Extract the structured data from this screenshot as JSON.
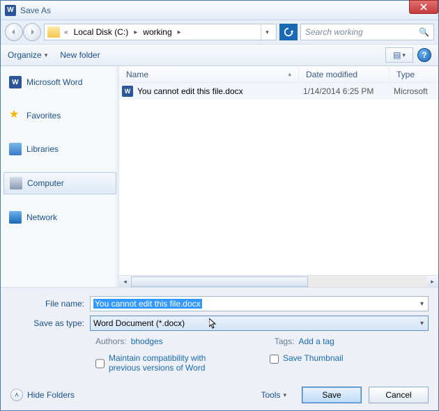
{
  "title": "Save As",
  "breadcrumb": {
    "root_marker": "«",
    "drive": "Local Disk (C:)",
    "folder": "working"
  },
  "search": {
    "placeholder": "Search working"
  },
  "toolbar": {
    "organize": "Organize",
    "new_folder": "New folder"
  },
  "sidebar": {
    "items": [
      {
        "label": "Microsoft Word"
      },
      {
        "label": "Favorites"
      },
      {
        "label": "Libraries"
      },
      {
        "label": "Computer"
      },
      {
        "label": "Network"
      }
    ]
  },
  "columns": {
    "name": "Name",
    "date": "Date modified",
    "type": "Type"
  },
  "files": [
    {
      "name": "You cannot edit this file.docx",
      "date": "1/14/2014 6:25 PM",
      "type": "Microsoft"
    }
  ],
  "form": {
    "file_name_label": "File name:",
    "file_name_value": "You cannot edit this file.docx",
    "save_type_label": "Save as type:",
    "save_type_value": "Word Document (*.docx)",
    "authors_label": "Authors:",
    "authors_value": "bhodges",
    "tags_label": "Tags:",
    "tags_value": "Add a tag",
    "maintain_compat": "Maintain compatibility with previous versions of Word",
    "save_thumbnail": "Save Thumbnail"
  },
  "footer": {
    "hide_folders": "Hide Folders",
    "tools": "Tools",
    "save": "Save",
    "cancel": "Cancel"
  }
}
